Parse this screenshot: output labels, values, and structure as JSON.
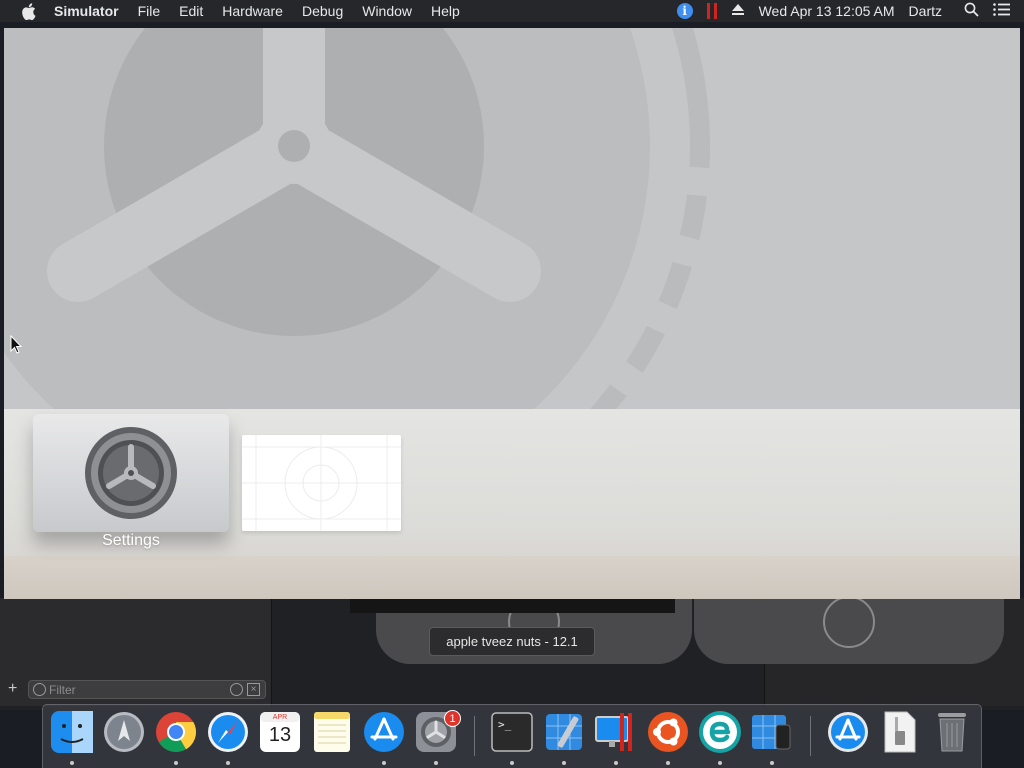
{
  "menubar": {
    "app_name": "Simulator",
    "items": [
      "File",
      "Edit",
      "Hardware",
      "Debug",
      "Window",
      "Help"
    ],
    "clock": "Wed Apr 13  12:05 AM",
    "user": "Dartz",
    "status_icons": [
      "info-icon",
      "pause-icon",
      "eject-icon",
      "search-icon",
      "menu-list-icon"
    ]
  },
  "simulator": {
    "focused_app": "Settings"
  },
  "xcode": {
    "tooltip": "apple tveez nuts - 12.1",
    "filter_placeholder": "Filter",
    "add_label": "+"
  },
  "dock": {
    "calendar_month": "APR",
    "calendar_day": "13",
    "badge_count": "1",
    "terminal_prompt": ">_",
    "items": [
      "finder",
      "launchpad",
      "chrome",
      "safari",
      "calendar",
      "notes",
      "app-store",
      "system-preferences",
      "terminal",
      "xcode",
      "parallels",
      "ubuntu",
      "eset",
      "simulator",
      "app-store-utility",
      "archive",
      "trash"
    ]
  },
  "colors": {
    "menubar_bg": "#26272b",
    "info_blue": "#3f8ff0",
    "pause_red": "#d0241d",
    "badge_red": "#e0332b",
    "tv_background": "#c4c6c7"
  }
}
